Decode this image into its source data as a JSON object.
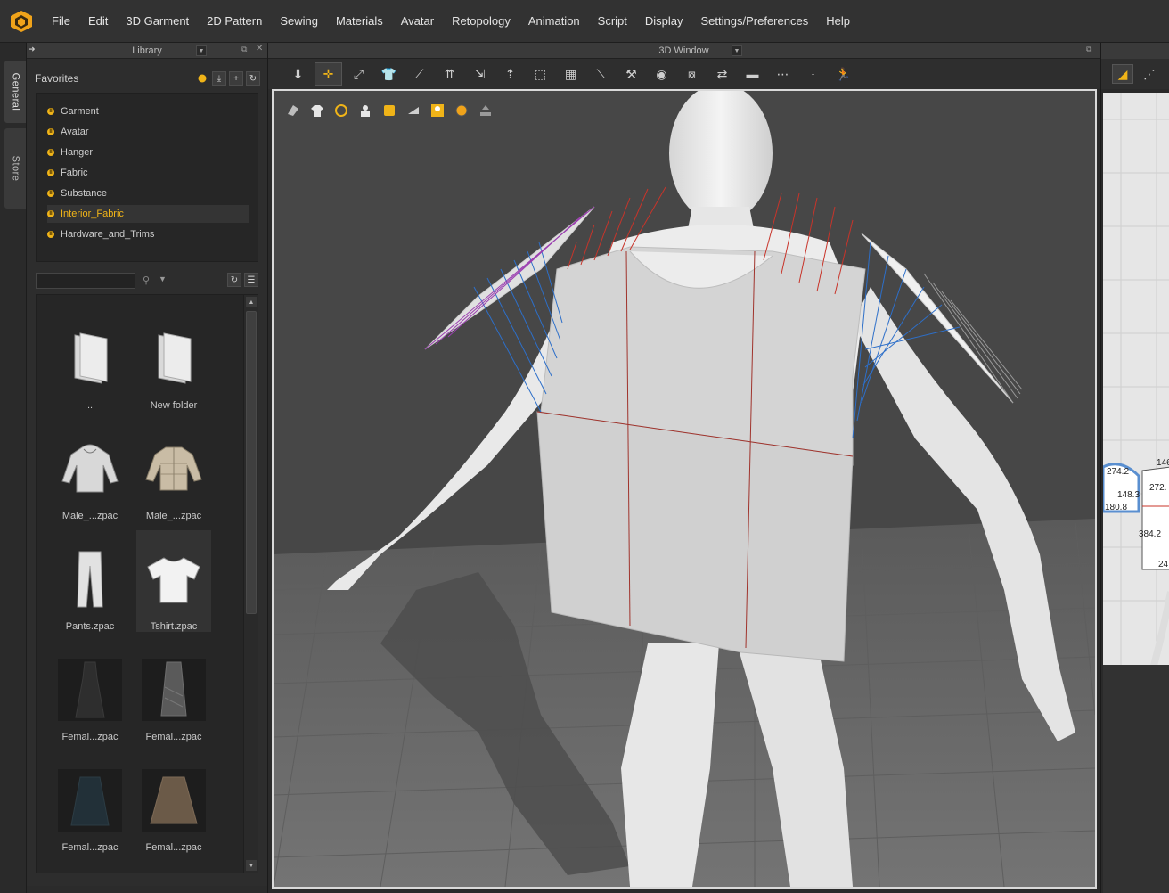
{
  "menubar": {
    "logo": "clo-logo-icon",
    "items": [
      "File",
      "Edit",
      "3D Garment",
      "2D Pattern",
      "Sewing",
      "Materials",
      "Avatar",
      "Retopology",
      "Animation",
      "Script",
      "Display",
      "Settings/Preferences",
      "Help"
    ]
  },
  "side_tabs": {
    "general": "General",
    "store": "Store"
  },
  "library": {
    "header_title": "Library",
    "favorites_title": "Favorites",
    "favorites": [
      "Garment",
      "Avatar",
      "Hanger",
      "Fabric",
      "Substance",
      "Interior_Fabric",
      "Hardware_and_Trims"
    ],
    "selected_favorite": "Interior_Fabric",
    "search": {
      "value": "",
      "placeholder": ""
    },
    "files": [
      {
        "label": "..",
        "icon": "folder-icon"
      },
      {
        "label": "New folder",
        "icon": "folder-icon"
      },
      {
        "label": "Male_...zpac",
        "icon": "hoodie-icon"
      },
      {
        "label": "Male_...zpac",
        "icon": "puffer-jacket-icon"
      },
      {
        "label": "Pants.zpac",
        "icon": "pants-icon"
      },
      {
        "label": "Tshirt.zpac",
        "icon": "tshirt-icon"
      },
      {
        "label": "Femal...zpac",
        "icon": "dress-icon"
      },
      {
        "label": "Femal...zpac",
        "icon": "dress-icon"
      },
      {
        "label": "Femal...zpac",
        "icon": "skirt-icon"
      },
      {
        "label": "Femal...zpac",
        "icon": "skirt-icon"
      }
    ],
    "selected_file": "Tshirt.zpac"
  },
  "window3d": {
    "header_title": "3D Window"
  },
  "window2d": {
    "dimensions": [
      "274.2",
      "148.3",
      "180.8",
      "272.",
      "384.2",
      "24",
      "146"
    ]
  },
  "colors": {
    "accent": "#f0b418",
    "viewport_border": "#d9d9d9",
    "seam_red": "#c8342a",
    "seam_blue": "#2d6fc9",
    "seam_purple": "#9b3fb0"
  }
}
